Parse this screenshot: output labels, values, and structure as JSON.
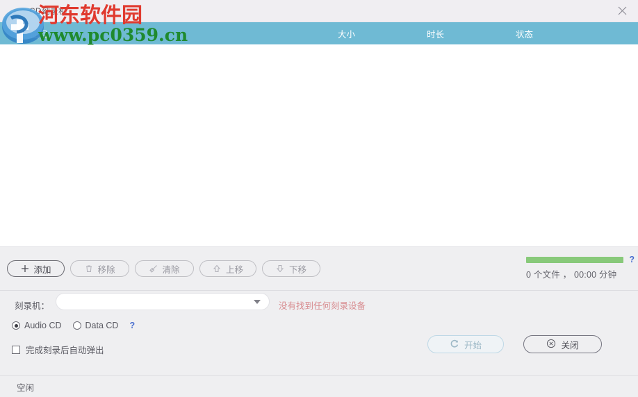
{
  "window": {
    "title": "CD刻录机",
    "close_icon": "close-icon"
  },
  "list_header": {
    "track": "曲目",
    "size": "大小",
    "duration": "时长",
    "status": "状态"
  },
  "toolbar": {
    "add_label": "添加",
    "add_icon": "plus-icon",
    "remove_label": "移除",
    "remove_icon": "trash-icon",
    "clear_label": "清除",
    "clear_icon": "broom-icon",
    "move_up_label": "上移",
    "move_up_icon": "arrow-up-icon",
    "move_down_label": "下移",
    "move_down_icon": "arrow-down-icon",
    "summary_text": "0 个文件 ， 00:00 分钟",
    "progress_percent": 100,
    "progress_color": "#88c97a",
    "help_label": "?"
  },
  "options": {
    "burner_label": "刻录机：",
    "burner_value": "",
    "burner_placeholder": "",
    "burner_warning": "没有找到任何刻录设备",
    "warning_color": "#d88c90",
    "disc_types": [
      {
        "label": "Audio CD",
        "selected": true
      },
      {
        "label": "Data CD",
        "selected": false
      }
    ],
    "disc_type_help": "?",
    "auto_eject_label": "完成刻录后自动弹出",
    "auto_eject_checked": false,
    "start_label": "开始",
    "start_icon": "refresh-icon",
    "close_label": "关闭",
    "close_icon": "circle-x-icon"
  },
  "statusbar": {
    "text": "空闲"
  },
  "watermark": {
    "site_name": "河东软件园",
    "site_url": "www.pc0359.cn",
    "name_color": "#e03a2f",
    "url_color": "#1f8a2e"
  },
  "theme": {
    "header_bar": "#6fbad4",
    "titlebar": "#f0eef2",
    "panel": "#efeff1",
    "link": "#4a6fd0"
  }
}
